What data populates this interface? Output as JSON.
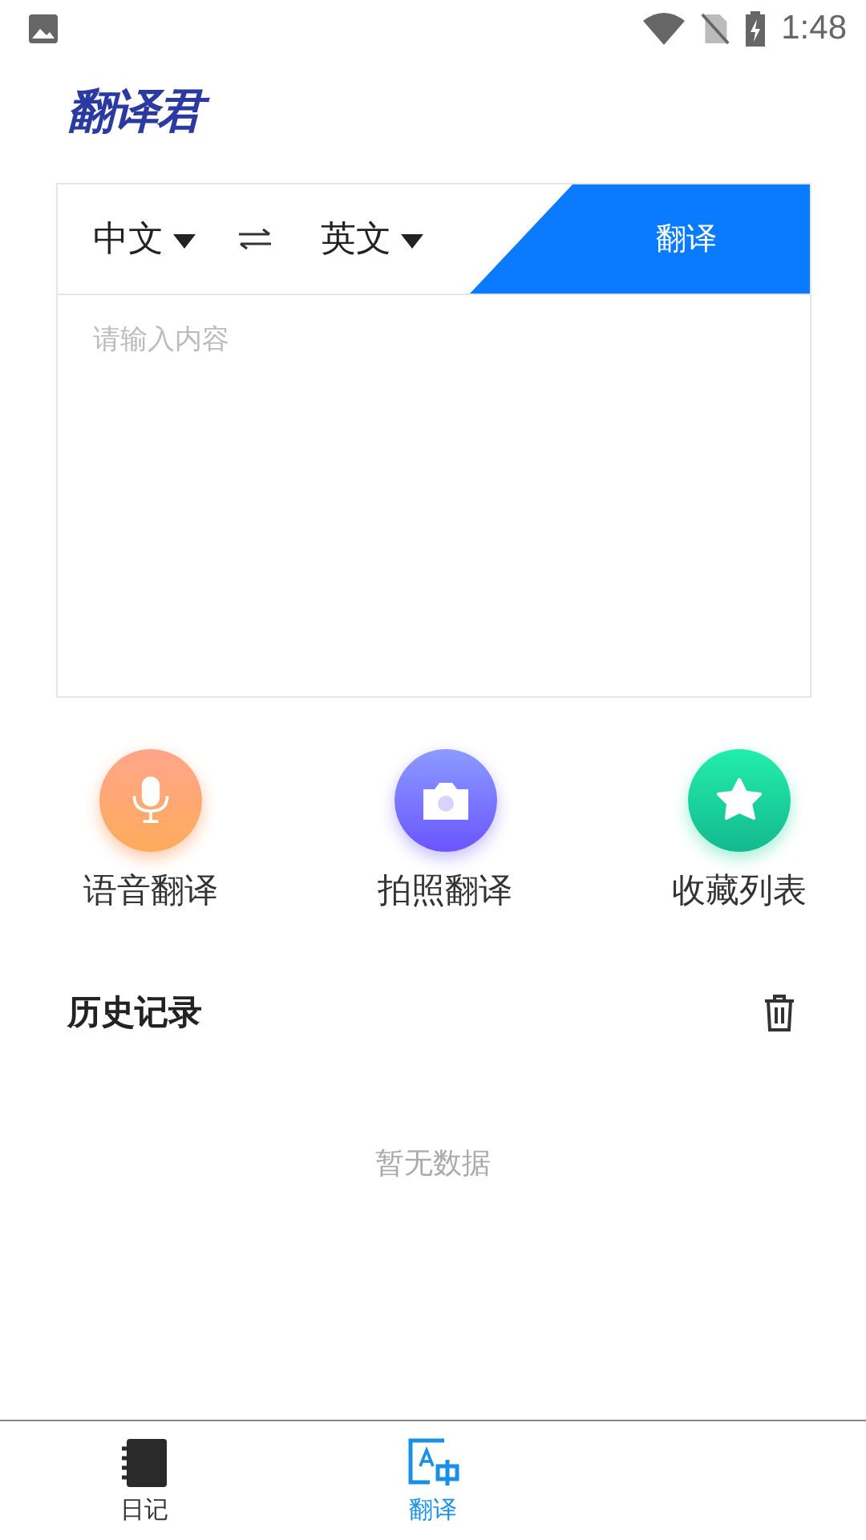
{
  "status_bar": {
    "time": "1:48"
  },
  "app_title": "翻译君",
  "translator": {
    "source_language": "中文",
    "target_language": "英文",
    "translate_button": "翻译",
    "input": {
      "placeholder": "请输入内容"
    }
  },
  "features": [
    {
      "kind": "voice",
      "label": "语音翻译"
    },
    {
      "kind": "camera",
      "label": "拍照翻译"
    },
    {
      "kind": "favorites",
      "label": "收藏列表"
    }
  ],
  "history": {
    "title": "历史记录",
    "empty_text": "暂无数据"
  },
  "bottom_nav": [
    {
      "kind": "diary",
      "label": "日记",
      "selected": false
    },
    {
      "kind": "translate",
      "label": "翻译",
      "selected": true
    }
  ]
}
